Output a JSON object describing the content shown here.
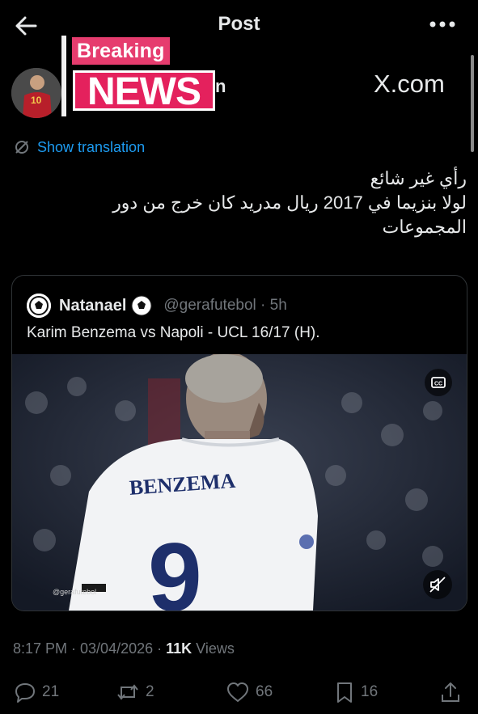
{
  "header": {
    "title": "Post"
  },
  "badge": {
    "breaking": "Breaking",
    "news": "NEWS",
    "name_tail": "n"
  },
  "avatar": {
    "jersey_number": "10"
  },
  "brand": {
    "xcom": "X.com"
  },
  "translation": {
    "label": "Show translation"
  },
  "tweet": {
    "lines": [
      "رأي غير شائع",
      "لولا بنزيما في 2017 ريال مدريد كان خرج من دور",
      "المجموعات"
    ]
  },
  "quote": {
    "name": "Natanael",
    "handle": "@gerafutebol · 5h",
    "text": "Karim Benzema vs Napoli - UCL 16/17 (H).",
    "jersey_name": "BENZEMA",
    "jersey_number": "9",
    "watermark": "@gerafutebol"
  },
  "meta": {
    "time": "8:17 PM · 03/04/2026 · ",
    "views_count": "11K",
    "views_label": " Views"
  },
  "actions": {
    "replies": "21",
    "reposts": "2",
    "likes": "66",
    "bookmarks": "16"
  },
  "colors": {
    "accent": "#1d9bf0",
    "badge": "#e4215d",
    "muted": "#71767b"
  },
  "icons": [
    "back-arrow-icon",
    "more-icon",
    "translate-icon",
    "verified-badge-icon",
    "cc-icon",
    "mute-icon",
    "reply-icon",
    "repost-icon",
    "like-icon",
    "bookmark-icon",
    "share-icon"
  ]
}
